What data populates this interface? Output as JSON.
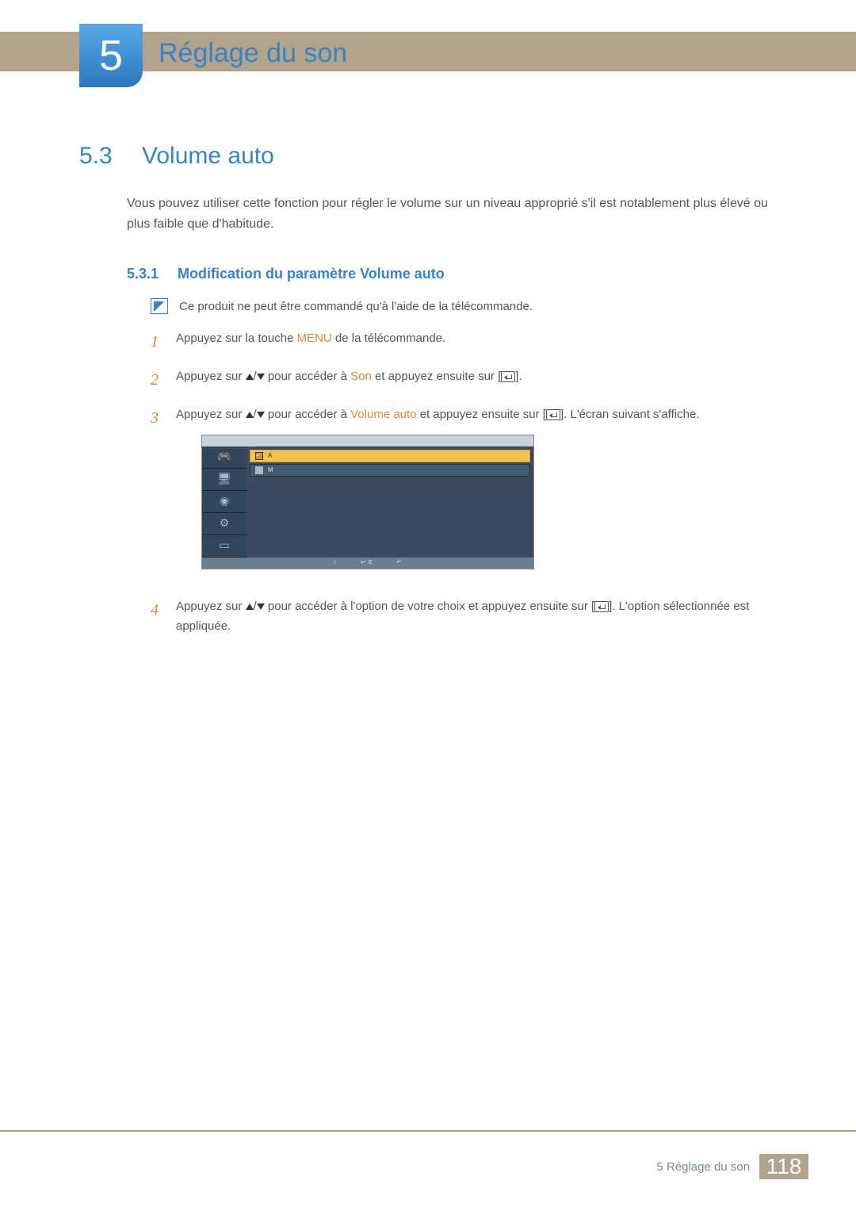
{
  "chapter": {
    "number": "5",
    "title": "Réglage du son"
  },
  "section": {
    "number": "5.3",
    "title": "Volume auto"
  },
  "intro": "Vous pouvez utiliser cette fonction pour régler le volume sur un niveau approprié s'il est notablement plus élevé ou plus faible que d'habitude.",
  "subsection": {
    "number": "5.3.1",
    "title": "Modification du paramètre Volume auto"
  },
  "note": "Ce produit ne peut être commandé qu'à l'aide de la télécommande.",
  "steps": {
    "s1_pre": "Appuyez sur la touche ",
    "s1_hl": "MENU",
    "s1_post": " de la télécommande.",
    "s2_pre": "Appuyez sur ",
    "s2_mid": " pour accéder à ",
    "s2_hl": "Son",
    "s2_post": " et appuyez ensuite sur [",
    "s2_end": "].",
    "s3_pre": "Appuyez sur ",
    "s3_mid": " pour accéder à ",
    "s3_hl": "Volume auto",
    "s3_post": " et appuyez ensuite sur [",
    "s3_end": "]. L'écran suivant s'affiche.",
    "s4_pre": "Appuyez sur ",
    "s4_mid": " pour accéder à l'option de votre choix et appuyez ensuite sur [",
    "s4_end": "]. L'option sélectionnée est appliquée."
  },
  "osd": {
    "row1_label": "A",
    "row1_check": "✓",
    "row2_label": "M",
    "bottom_move": " ",
    "bottom_enter": "E",
    "bottom_return": " "
  },
  "footer": {
    "label": "5 Réglage du son",
    "page": "118"
  }
}
